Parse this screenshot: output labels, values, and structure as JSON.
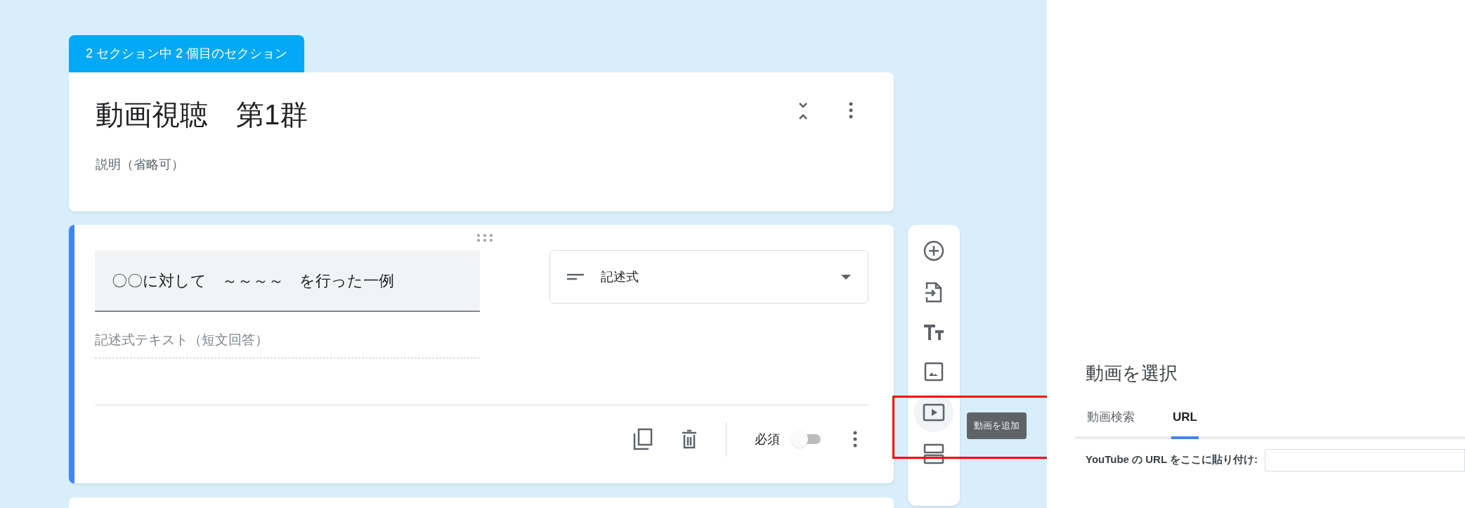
{
  "section_tab": "2 セクション中 2 個目のセクション",
  "section_card": {
    "title": "動画視聴　第1群",
    "description_placeholder": "説明（省略可）"
  },
  "question": {
    "title": "〇〇に対して　～～～～　を行った一例",
    "type": "記述式",
    "answer_placeholder": "記述式テキスト（短文回答）",
    "required_label": "必須",
    "required": false
  },
  "toolbar": {
    "tooltip": "動画を追加",
    "highlighted": true
  },
  "video_dialog": {
    "title": "動画を選択",
    "tabs": [
      {
        "label": "動画検索",
        "selected": false
      },
      {
        "label": "URL",
        "selected": true
      }
    ],
    "url_label": "YouTube の URL をここに貼り付け:"
  }
}
